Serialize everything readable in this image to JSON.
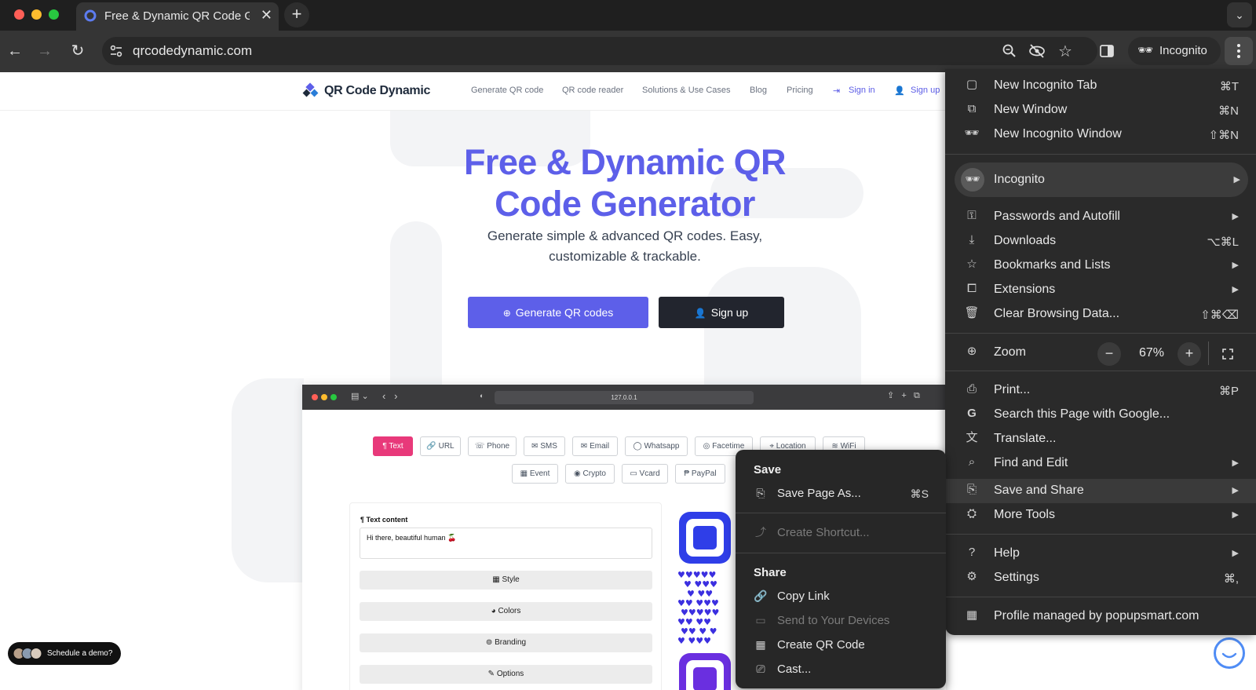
{
  "browser": {
    "tab_title": "Free & Dynamic QR Code Generator",
    "url": "qrcodedynamic.com",
    "incognito_label": "Incognito"
  },
  "site": {
    "logo": "QR Code Dynamic",
    "nav": [
      "Generate QR code",
      "QR code reader",
      "Solutions & Use Cases",
      "Blog",
      "Pricing"
    ],
    "sign_in": "Sign in",
    "sign_up": "Sign up",
    "hero_title_1": "Free & Dynamic QR",
    "hero_title_2": "Code Generator",
    "hero_sub_1": "Generate simple & advanced QR codes. Easy,",
    "hero_sub_2": "customizable & trackable.",
    "btn_generate": "Generate QR codes",
    "btn_signup": "Sign up",
    "brand_color": "#5d5fe9",
    "demo": "Schedule a demo?"
  },
  "mock": {
    "url": "127.0.0.1",
    "types_row1": [
      "Text",
      "URL",
      "Phone",
      "SMS",
      "Email",
      "Whatsapp",
      "Facetime",
      "Location",
      "WiFi"
    ],
    "types_row2": [
      "Event",
      "Crypto",
      "Vcard",
      "PayPal"
    ],
    "text_content_label": "Text content",
    "text_content_value": "Hi there, beautiful human 🍒",
    "sections": [
      "Style",
      "Colors",
      "Branding",
      "Options"
    ]
  },
  "menu": {
    "new_incognito_tab": "New Incognito Tab",
    "new_incognito_tab_sc": "⌘T",
    "new_window": "New Window",
    "new_window_sc": "⌘N",
    "new_incognito_window": "New Incognito Window",
    "new_incognito_window_sc": "⇧⌘N",
    "incognito": "Incognito",
    "passwords": "Passwords and Autofill",
    "downloads": "Downloads",
    "downloads_sc": "⌥⌘L",
    "bookmarks": "Bookmarks and Lists",
    "extensions": "Extensions",
    "clear": "Clear Browsing Data...",
    "clear_sc": "⇧⌘⌫",
    "zoom": "Zoom",
    "zoom_value": "67%",
    "print": "Print...",
    "print_sc": "⌘P",
    "search_google": "Search this Page with Google...",
    "translate": "Translate...",
    "find_edit": "Find and Edit",
    "save_share": "Save and Share",
    "more_tools": "More Tools",
    "help": "Help",
    "settings": "Settings",
    "settings_sc": "⌘,",
    "profile": "Profile managed by popupsmart.com"
  },
  "submenu": {
    "save_head": "Save",
    "save_page_as": "Save Page As...",
    "save_page_as_sc": "⌘S",
    "create_shortcut": "Create Shortcut...",
    "share_head": "Share",
    "copy_link": "Copy Link",
    "send_devices": "Send to Your Devices",
    "create_qr": "Create QR Code",
    "cast": "Cast..."
  }
}
